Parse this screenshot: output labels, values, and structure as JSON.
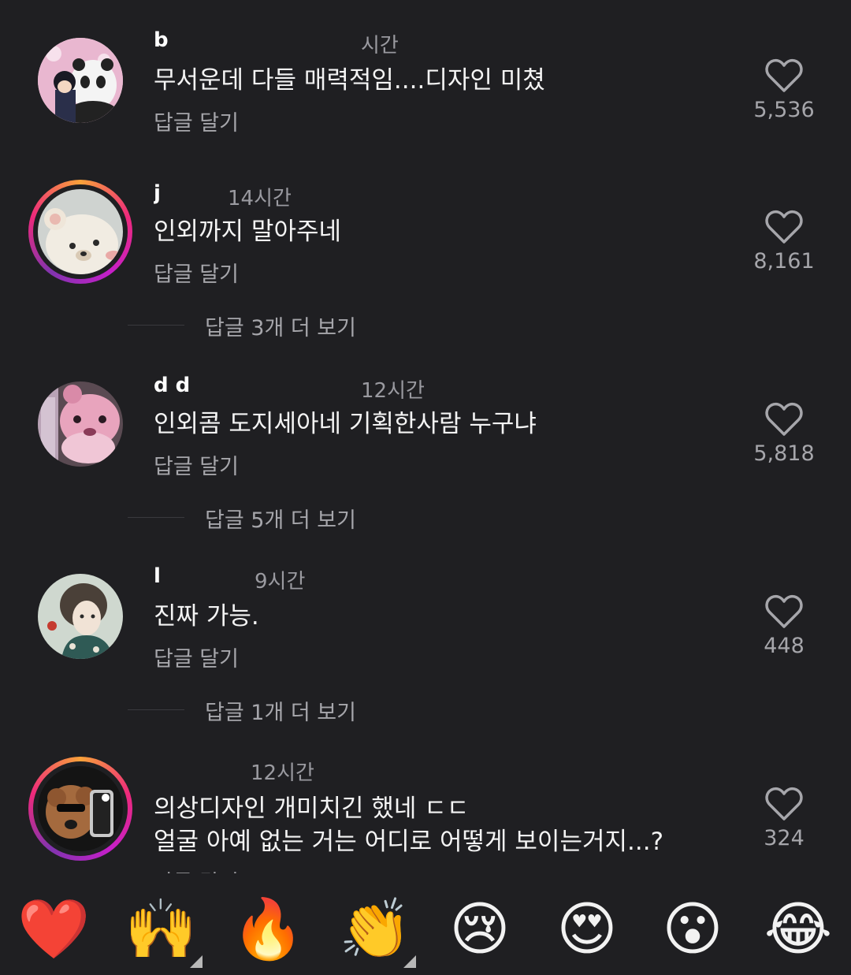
{
  "comments": [
    {
      "username": "b",
      "time": "시간",
      "text": "무서운데 다들 매력적임....디자인 미쳤",
      "reply": "답글 달기",
      "likes": "5,536",
      "ring": false
    },
    {
      "username": "j",
      "time": "14시간",
      "text": "인외까지 말아주네",
      "reply": "답글 달기",
      "likes": "8,161",
      "ring": true,
      "view_more": "답글 3개 더 보기"
    },
    {
      "username": "d d",
      "time": "12시간",
      "text": "인외콤 도지세아네 기획한사람 누구냐",
      "reply": "답글 달기",
      "likes": "5,818",
      "ring": false,
      "view_more": "답글 5개 더 보기"
    },
    {
      "username": "l",
      "time": "9시간",
      "text": "진짜 가능.",
      "reply": "답글 달기",
      "likes": "448",
      "ring": false,
      "view_more": "답글 1개 더 보기"
    },
    {
      "username": "",
      "time": "12시간",
      "text_line1": "의상디자인 개미치긴 했네 ㄷㄷ",
      "text_line2": "얼굴 아예 없는 거는 어디로 어떻게 보이는거지...?",
      "reply": "답글 달기",
      "likes": "324",
      "ring": true
    }
  ],
  "emoji_bar": [
    "❤️",
    "🙌",
    "🔥",
    "👏",
    "😢",
    "😍",
    "😮",
    "😂"
  ],
  "colors": {
    "background": "#1f1f22",
    "muted": "#a6a6ab",
    "ring_start": "#f9a23a",
    "ring_mid": "#ee2a7b"
  }
}
